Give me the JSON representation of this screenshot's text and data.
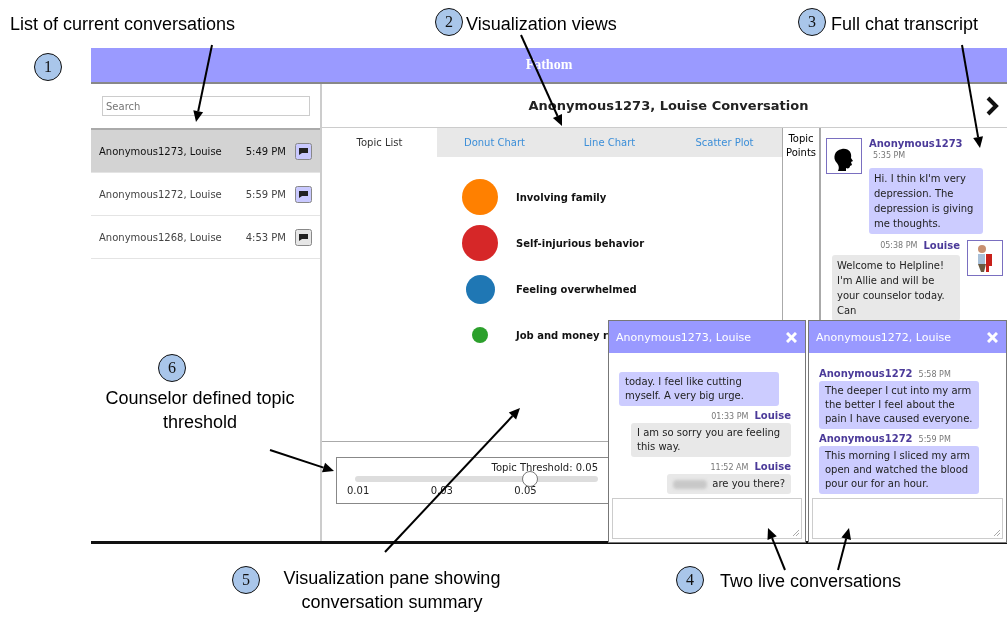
{
  "annotations": [
    {
      "number": "1",
      "text": "List of current conversations"
    },
    {
      "number": "2",
      "text": "Visualization views"
    },
    {
      "number": "3",
      "text": "Full chat transcript"
    },
    {
      "number": "6",
      "text": "Counselor defined topic threshold"
    },
    {
      "number": "5",
      "text": "Visualization pane showing conversation summary"
    },
    {
      "number": "4",
      "text": "Two live conversations"
    }
  ],
  "app": {
    "title": "Fathom",
    "search": {
      "placeholder": "Search"
    },
    "conversations": [
      {
        "name": "Anonymous1273, Louise",
        "time": "5:49 PM",
        "selected": true,
        "live": true
      },
      {
        "name": "Anonymous1272, Louise",
        "time": "5:59 PM",
        "selected": false,
        "live": true
      },
      {
        "name": "Anonymous1268, Louise",
        "time": "4:53 PM",
        "selected": false,
        "live": false
      }
    ],
    "conversation_title": "Anonymous1273, Louise Conversation",
    "tabs": [
      {
        "label": "Topic List",
        "selected": true
      },
      {
        "label": "Donut Chart",
        "selected": false
      },
      {
        "label": "Line Chart",
        "selected": false
      },
      {
        "label": "Scatter Plot",
        "selected": false
      }
    ],
    "topics": [
      {
        "label": "Involving family",
        "color": "#ff8000",
        "kind": "large"
      },
      {
        "label": "Self-injurious behavior",
        "color": "#d62728",
        "kind": "large"
      },
      {
        "label": "Feeling overwhelmed",
        "color": "#1f77b4",
        "kind": "medium"
      },
      {
        "label": "Job and money r",
        "color": "#2ca02c",
        "kind": "small"
      }
    ],
    "threshold": {
      "label": "Topic Threshold: 0.05",
      "level": 0.72,
      "ticks": [
        "0.01",
        "0.03",
        "0.05"
      ]
    },
    "topic_points_label": "Topic Points",
    "transcript": [
      {
        "kind": "patient",
        "sender": "Anonymous1273",
        "time": "5:35 PM",
        "text": "Hi. I thin kI'm very depression. The depression is giving me thoughts."
      },
      {
        "kind": "counselor",
        "sender": "Louise",
        "time": "05:38 PM",
        "text": "Welcome to Helpline! I'm Allie and will be your counselor today. Can"
      }
    ],
    "live_chats": [
      {
        "title": "Anonymous1273, Louise",
        "messages": [
          {
            "kind": "patient",
            "text": "today. I feel like cutting myself. A very big urge.",
            "blurred": false
          },
          {
            "kind": "counselor",
            "sender": "Louise",
            "time": "01:33 PM",
            "text": "I am so sorry you are feeling this way.",
            "blurred": false
          },
          {
            "kind": "counselor",
            "sender": "Louise",
            "time": "11:52 AM",
            "text": "are you there?",
            "blurred": true
          }
        ]
      },
      {
        "title": "Anonymous1272, Louise",
        "messages": [
          {
            "kind": "patient",
            "sender": "Anonymous1272",
            "time": "5:58 PM",
            "text": "The deeper I cut into my arm the better I feel about the pain I have caused everyone.",
            "blurred": false
          },
          {
            "kind": "patient",
            "sender": "Anonymous1272",
            "time": "5:59 PM",
            "text": "This morning I sliced my arm open and watched the blood pour our for an hour.",
            "blurred": false
          }
        ]
      }
    ]
  }
}
